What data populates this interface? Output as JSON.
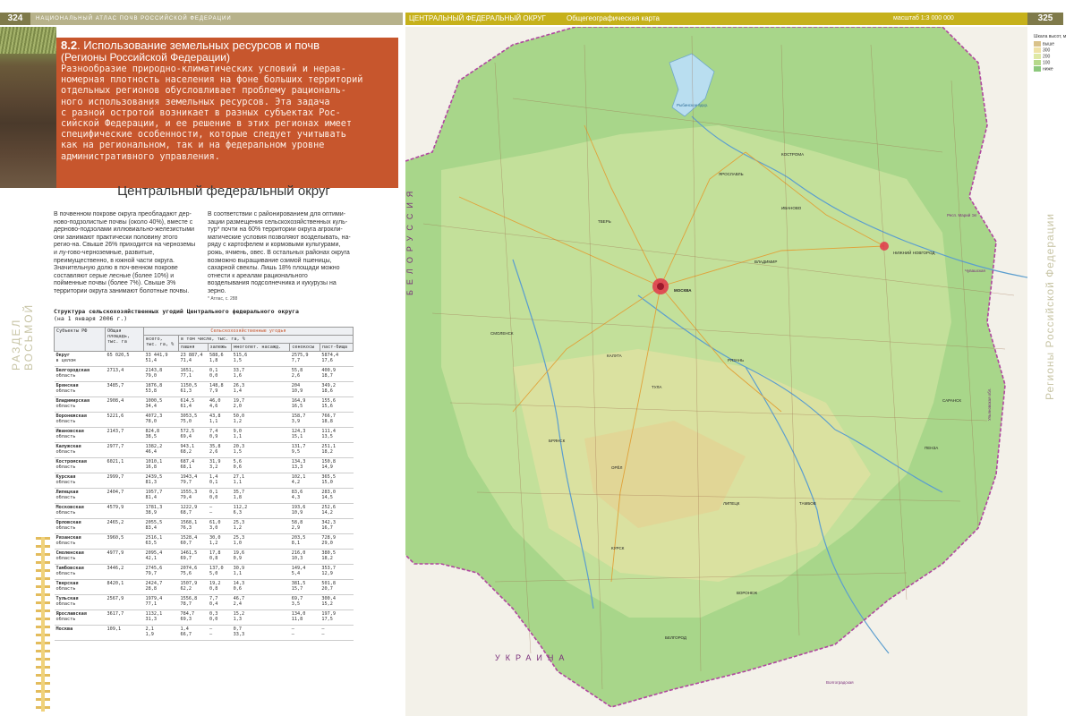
{
  "left_page": {
    "page_number": "324",
    "running_head": "НАЦИОНАЛЬНЫЙ АТЛАС ПОЧВ РОССИЙСКОЙ ФЕДЕРАЦИИ",
    "section_vertical": "РАЗДЕЛ ВОСЬМОЙ",
    "header": {
      "number": "8.2",
      "title": ". Использование земельных ресурсов и почв",
      "subtitle": "(Регионы Российской Федерации)",
      "intro": "Разнообразие природно-климатических условий и нерав-\nномерная плотность населения на фоне больших территорий\nотдельных регионов обусловливает проблему рациональ-\nного использования земельных ресурсов. Эта задача\nс разной остротой возникает в разных субъектах Рос-\nсийской Федерации, и ее решение в этих регионах имеет\nспецифические особенности, которые следует учитывать\nкак на региональном, так и на федеральном уровне\nадминистративного управления."
    },
    "section_title": "Центральный федеральный округ",
    "col1": "В почвенном покрове округа преобладают дер-ново-подзолистые почвы (около 40%), вместе с дерново-подзолами иллювиально-железистыми они занимают практически половину этого регио-на. Свыше 26% приходится на черноземы и лу-гово-черноземные, развитые, преимущественно, в южной части округа. Значительную долю в поч-венном покрове составляют серые лесные (более 10%) и пойменные почвы (более 7%). Свыше 3% территории округа занимают болотные почвы.",
    "col2": "В соответствии с районированием для оптими-зации размещения сельскохозяйственных куль-тур*  почти на 60% территории округа агрокли-матические условия позволяют возделывать, на-ряду с картофелем и кормовыми культурами, рожь, ячмень, овес. В остальных районах округа возможно выращивание озимой пшеницы, сахарной свеклы. Лишь 18% площади можно отнести к ареалам рационального возделывания подсолнечника и кукурузы на зерно.",
    "footnote": "*  Атлас, с. 288",
    "table": {
      "title": "Структура сельскохозяйственных угодий Центрального федерального округа",
      "date": "(на 1 января 2006 г.)",
      "head_subject": "Субъекты РФ",
      "head_area": "Общая площадь, тыс. га",
      "head_agri": "Сельскохозяйственные угодья",
      "head_total": "всего, тыс. га, %",
      "head_incl": "в том числе, тыс. га, %",
      "cols": [
        "пашня",
        "залежь",
        "многолет. насажд.",
        "сенокосы",
        "паст-бища"
      ],
      "rows": [
        {
          "name": "Округ",
          "sub": "в целом",
          "area": "65 020,5",
          "total": "33 441,9",
          "tp": "51,4",
          "c": [
            [
              "23 887,4",
              "71,4"
            ],
            [
              "588,6",
              "1,8"
            ],
            [
              "515,6",
              "1,5"
            ],
            [
              "2575,9",
              "7,7"
            ],
            [
              "5874,4",
              "17,6"
            ]
          ]
        },
        {
          "name": "Белгородская",
          "sub": "область",
          "area": "2713,4",
          "total": "2143,8",
          "tp": "79,0",
          "c": [
            [
              "1651,",
              "77,1"
            ],
            [
              "0,1",
              "0,0"
            ],
            [
              "33,7",
              "1,6"
            ],
            [
              "55,8",
              "2,6"
            ],
            [
              "400,9",
              "18,7"
            ]
          ]
        },
        {
          "name": "Брянская",
          "sub": "область",
          "area": "3485,7",
          "total": "1876,8",
          "tp": "53,8",
          "c": [
            [
              "1150,5",
              "61,3"
            ],
            [
              "148,8",
              "7,9"
            ],
            [
              "26,3",
              "1,4"
            ],
            [
              "204",
              "10,9"
            ],
            [
              "349,2",
              "18,6"
            ]
          ]
        },
        {
          "name": "Владимирская",
          "sub": "область",
          "area": "2908,4",
          "total": "1000,5",
          "tp": "34,4",
          "c": [
            [
              "614,5",
              "61,4"
            ],
            [
              "46,0",
              "4,6"
            ],
            [
              "19,7",
              "2,0"
            ],
            [
              "164,9",
              "16,5"
            ],
            [
              "155,6",
              "15,6"
            ]
          ]
        },
        {
          "name": "Воронежская",
          "sub": "область",
          "area": "5221,6",
          "total": "4072,3",
          "tp": "78,0",
          "c": [
            [
              "3053,5",
              "75,0"
            ],
            [
              "43,8",
              "1,1"
            ],
            [
              "50,0",
              "1,2"
            ],
            [
              "158,7",
              "3,9"
            ],
            [
              "766,7",
              "18,8"
            ]
          ]
        },
        {
          "name": "Ивановская",
          "sub": "область",
          "area": "2143,7",
          "total": "824,8",
          "tp": "38,5",
          "c": [
            [
              "572,5",
              "69,4"
            ],
            [
              "7,4",
              "0,9"
            ],
            [
              "9,0",
              "1,1"
            ],
            [
              "124,3",
              "15,1"
            ],
            [
              "111,4",
              "13,5"
            ]
          ]
        },
        {
          "name": "Калужская",
          "sub": "область",
          "area": "2977,7",
          "total": "1382,2",
          "tp": "46,4",
          "c": [
            [
              "943,1",
              "68,2"
            ],
            [
              "35,8",
              "2,6"
            ],
            [
              "20,3",
              "1,5"
            ],
            [
              "131,7",
              "9,5"
            ],
            [
              "251,1",
              "18,2"
            ]
          ]
        },
        {
          "name": "Костромская",
          "sub": "область",
          "area": "6021,1",
          "total": "1010,1",
          "tp": "16,8",
          "c": [
            [
              "687,4",
              "68,1"
            ],
            [
              "31,9",
              "3,2"
            ],
            [
              "5,6",
              "0,6"
            ],
            [
              "134,3",
              "13,3"
            ],
            [
              "150,8",
              "14,9"
            ]
          ]
        },
        {
          "name": "Курская",
          "sub": "область",
          "area": "2999,7",
          "total": "2439,5",
          "tp": "81,3",
          "c": [
            [
              "1943,4",
              "79,7"
            ],
            [
              "1,4",
              "0,1"
            ],
            [
              "27,1",
              "1,1"
            ],
            [
              "102,1",
              "4,2"
            ],
            [
              "365,5",
              "15,0"
            ]
          ]
        },
        {
          "name": "Липецкая",
          "sub": "область",
          "area": "2404,7",
          "total": "1957,7",
          "tp": "81,4",
          "c": [
            [
              "1555,3",
              "79,4"
            ],
            [
              "0,1",
              "0,0"
            ],
            [
              "35,7",
              "1,8"
            ],
            [
              "83,6",
              "4,3"
            ],
            [
              "283,0",
              "14,5"
            ]
          ]
        },
        {
          "name": "Московская",
          "sub": "область",
          "area": "4579,9",
          "total": "1781,3",
          "tp": "38,9",
          "c": [
            [
              "1222,9",
              "68,7"
            ],
            [
              "—",
              "—"
            ],
            [
              "112,2",
              "6,3"
            ],
            [
              "193,6",
              "10,9"
            ],
            [
              "252,6",
              "14,2"
            ]
          ]
        },
        {
          "name": "Орловская",
          "sub": "область",
          "area": "2465,2",
          "total": "2055,5",
          "tp": "83,4",
          "c": [
            [
              "1568,1",
              "76,3"
            ],
            [
              "61,0",
              "3,0"
            ],
            [
              "25,3",
              "1,2"
            ],
            [
              "58,8",
              "2,9"
            ],
            [
              "342,3",
              "16,7"
            ]
          ]
        },
        {
          "name": "Рязанская",
          "sub": "область",
          "area": "3960,5",
          "total": "2516,1",
          "tp": "63,5",
          "c": [
            [
              "1528,4",
              "60,7"
            ],
            [
              "30,0",
              "1,2"
            ],
            [
              "25,3",
              "1,0"
            ],
            [
              "203,5",
              "8,1"
            ],
            [
              "728,9",
              "29,0"
            ]
          ]
        },
        {
          "name": "Смоленская",
          "sub": "область",
          "area": "4977,9",
          "total": "2095,4",
          "tp": "42,1",
          "c": [
            [
              "1461,5",
              "69,7"
            ],
            [
              "17,8",
              "0,8"
            ],
            [
              "19,6",
              "0,9"
            ],
            [
              "216,0",
              "10,3"
            ],
            [
              "380,5",
              "18,2"
            ]
          ]
        },
        {
          "name": "Тамбовская",
          "sub": "область",
          "area": "3446,2",
          "total": "2745,6",
          "tp": "79,7",
          "c": [
            [
              "2074,6",
              "75,6"
            ],
            [
              "137,0",
              "5,0"
            ],
            [
              "30,9",
              "1,1"
            ],
            [
              "149,4",
              "5,4"
            ],
            [
              "353,7",
              "12,9"
            ]
          ]
        },
        {
          "name": "Тверская",
          "sub": "область",
          "area": "8420,1",
          "total": "2424,7",
          "tp": "28,8",
          "c": [
            [
              "1507,9",
              "62,2"
            ],
            [
              "19,2",
              "0,8"
            ],
            [
              "14,3",
              "0,6"
            ],
            [
              "381,5",
              "15,7"
            ],
            [
              "501,8",
              "20,7"
            ]
          ]
        },
        {
          "name": "Тульская",
          "sub": "область",
          "area": "2567,9",
          "total": "1979,4",
          "tp": "77,1",
          "c": [
            [
              "1556,8",
              "78,7"
            ],
            [
              "7,7",
              "0,4"
            ],
            [
              "46,7",
              "2,4"
            ],
            [
              "69,7",
              "3,5"
            ],
            [
              "300,4",
              "15,2"
            ]
          ]
        },
        {
          "name": "Ярославская",
          "sub": "область",
          "area": "3617,7",
          "total": "1132,1",
          "tp": "31,3",
          "c": [
            [
              "784,7",
              "69,3"
            ],
            [
              "0,3",
              "0,0"
            ],
            [
              "15,2",
              "1,3"
            ],
            [
              "134,0",
              "11,8"
            ],
            [
              "197,9",
              "17,5"
            ]
          ]
        },
        {
          "name": "Москва",
          "sub": "",
          "area": "109,1",
          "total": "2,1",
          "tp": "1,9",
          "c": [
            [
              "1,4",
              "66,7"
            ],
            [
              "—",
              "—"
            ],
            [
              "0,7",
              "33,3"
            ],
            [
              "—",
              "—"
            ],
            [
              "—",
              "—"
            ]
          ]
        }
      ]
    }
  },
  "right_page": {
    "page_number": "325",
    "running_head_region": "ЦЕНТРАЛЬНЫЙ ФЕДЕРАЛЬНЫЙ ОКРУГ",
    "running_head_map": "Общегеографическая карта",
    "scale": "масштаб 1:3 000 000",
    "region_vertical": "Регионы Российской Федерации",
    "legend": {
      "title": "Шкала высот, м",
      "items": [
        {
          "label": "выше",
          "color": "#d9c28a"
        },
        {
          "label": "300",
          "color": "#efe2a6"
        },
        {
          "label": "200",
          "color": "#dfe9a5"
        },
        {
          "label": "100",
          "color": "#b6d98b"
        },
        {
          "label": "ниже",
          "color": "#8cc87c"
        }
      ]
    },
    "cities": [
      {
        "name": "МОСКВА",
        "x": "s"
      },
      {
        "name": "ЯРОСЛАВЛЬ"
      },
      {
        "name": "КОСТРОМА"
      },
      {
        "name": "НИЖНИЙ НОВГОРОД"
      },
      {
        "name": "Рыбинское вдхр."
      },
      {
        "name": "СМОЛЕНСК"
      },
      {
        "name": "ТВЕРЬ"
      },
      {
        "name": "РЯЗАНЬ"
      },
      {
        "name": "ТУЛА"
      },
      {
        "name": "КАЛУГА"
      },
      {
        "name": "ОРЁЛ"
      },
      {
        "name": "КУРСК"
      },
      {
        "name": "ВОРОНЕЖ"
      },
      {
        "name": "ЛИПЕЦК"
      },
      {
        "name": "ТАМБОВ"
      },
      {
        "name": "БЕЛГОРОД"
      },
      {
        "name": "БРЯНСК"
      },
      {
        "name": "ВЛАДИМИР"
      },
      {
        "name": "ИВАНОВО"
      },
      {
        "name": "САРАНСК"
      },
      {
        "name": "ПЕНЗА"
      },
      {
        "name": "Респ. Марий Эл"
      },
      {
        "name": "Чувашская"
      },
      {
        "name": "Ульяновская обл."
      },
      {
        "name": "БЕЛОРУССИЯ"
      },
      {
        "name": "УКРАИНА"
      },
      {
        "name": "Волгоградская"
      }
    ]
  }
}
